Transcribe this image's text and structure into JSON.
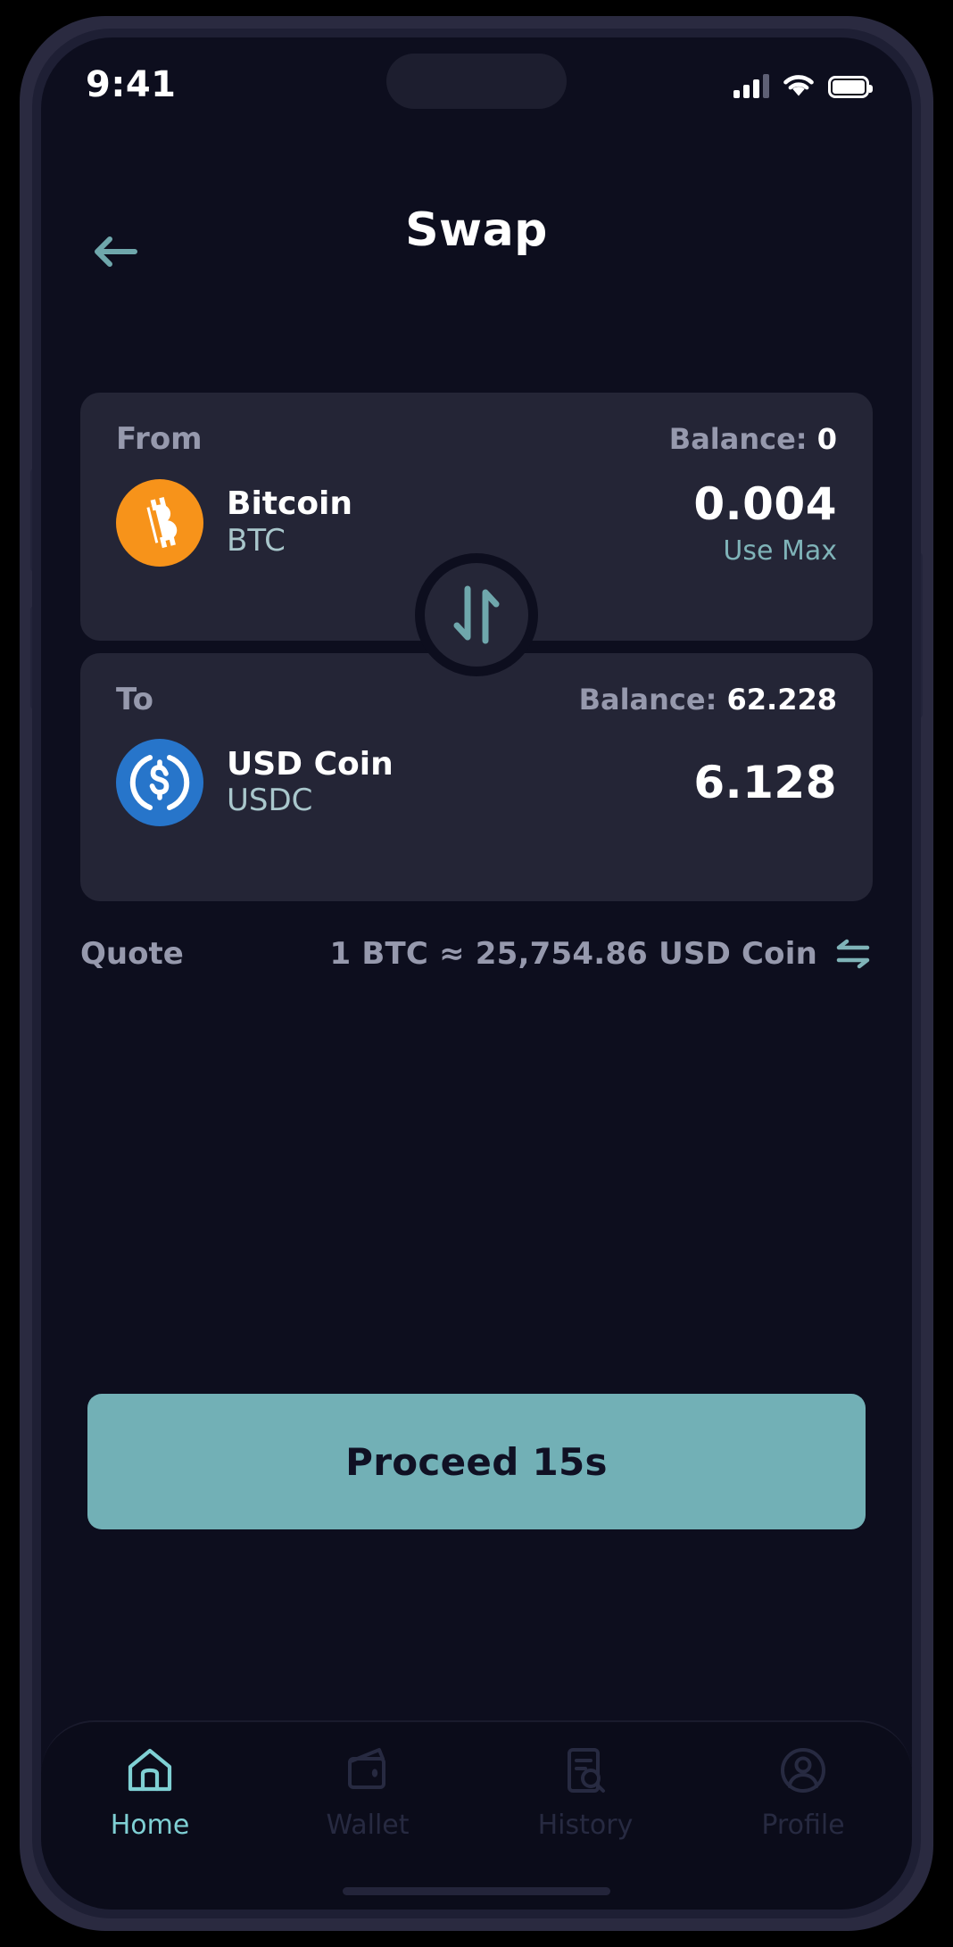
{
  "status_bar": {
    "time": "9:41",
    "signal_icon": "cellular-signal-icon",
    "wifi_icon": "wifi-icon",
    "battery_icon": "battery-full-icon"
  },
  "header": {
    "title": "Swap",
    "back_icon": "arrow-left-icon"
  },
  "swap": {
    "from": {
      "direction_label": "From",
      "balance_prefix": "Balance: ",
      "balance_value": "0",
      "token_name": "Bitcoin",
      "token_symbol": "BTC",
      "token_logo": "bitcoin-logo-icon",
      "amount": "0.004",
      "use_max_label": "Use Max"
    },
    "to": {
      "direction_label": "To",
      "balance_prefix": "Balance: ",
      "balance_value": "62.228",
      "token_name": "USD Coin",
      "token_symbol": "USDC",
      "token_logo": "usdc-logo-icon",
      "amount": "6.128"
    },
    "toggle_icon": "swap-vertical-arrows-icon"
  },
  "quote": {
    "label": "Quote",
    "value": "1 BTC ≈ 25,754.86 USD Coin",
    "reverse_icon": "swap-horizontal-arrows-icon"
  },
  "proceed": {
    "label": "Proceed 15s"
  },
  "bottom_nav": {
    "items": [
      {
        "label": "Home",
        "icon": "home-icon",
        "active": true
      },
      {
        "label": "Wallet",
        "icon": "wallet-icon",
        "active": false
      },
      {
        "label": "History",
        "icon": "history-search-icon",
        "active": false
      },
      {
        "label": "Profile",
        "icon": "profile-icon",
        "active": false
      }
    ]
  },
  "colors": {
    "page_background": "#0d0e1e",
    "card_background": "#242536",
    "accent_teal": "#72b0b6",
    "accent_teal_light": "#7fd0d4",
    "muted_text": "#9699ad",
    "bitcoin_orange": "#f7931a",
    "usdc_blue": "#2775ca",
    "white": "#ffffff"
  }
}
